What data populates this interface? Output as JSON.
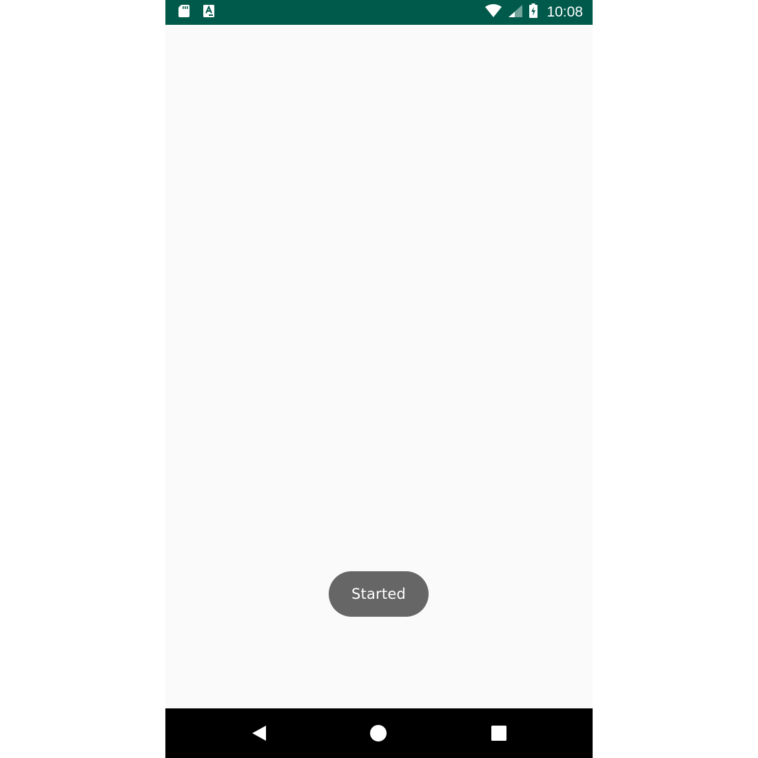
{
  "colors": {
    "status_bar": "#005a4b",
    "screen_background": "#fafafa",
    "toast_background": "#666666",
    "toast_text": "#ffffff",
    "nav_bar": "#000000",
    "nav_icons": "#ffffff"
  },
  "status_bar": {
    "left_icons": [
      "sd-card-icon",
      "app-notification-icon"
    ],
    "right_icons": [
      "wifi-icon",
      "cellular-signal-icon",
      "battery-charging-icon"
    ],
    "time": "10:08"
  },
  "toast": {
    "text": "Started"
  },
  "navigation_bar": {
    "buttons": [
      "back-icon",
      "home-icon",
      "recents-icon"
    ]
  }
}
